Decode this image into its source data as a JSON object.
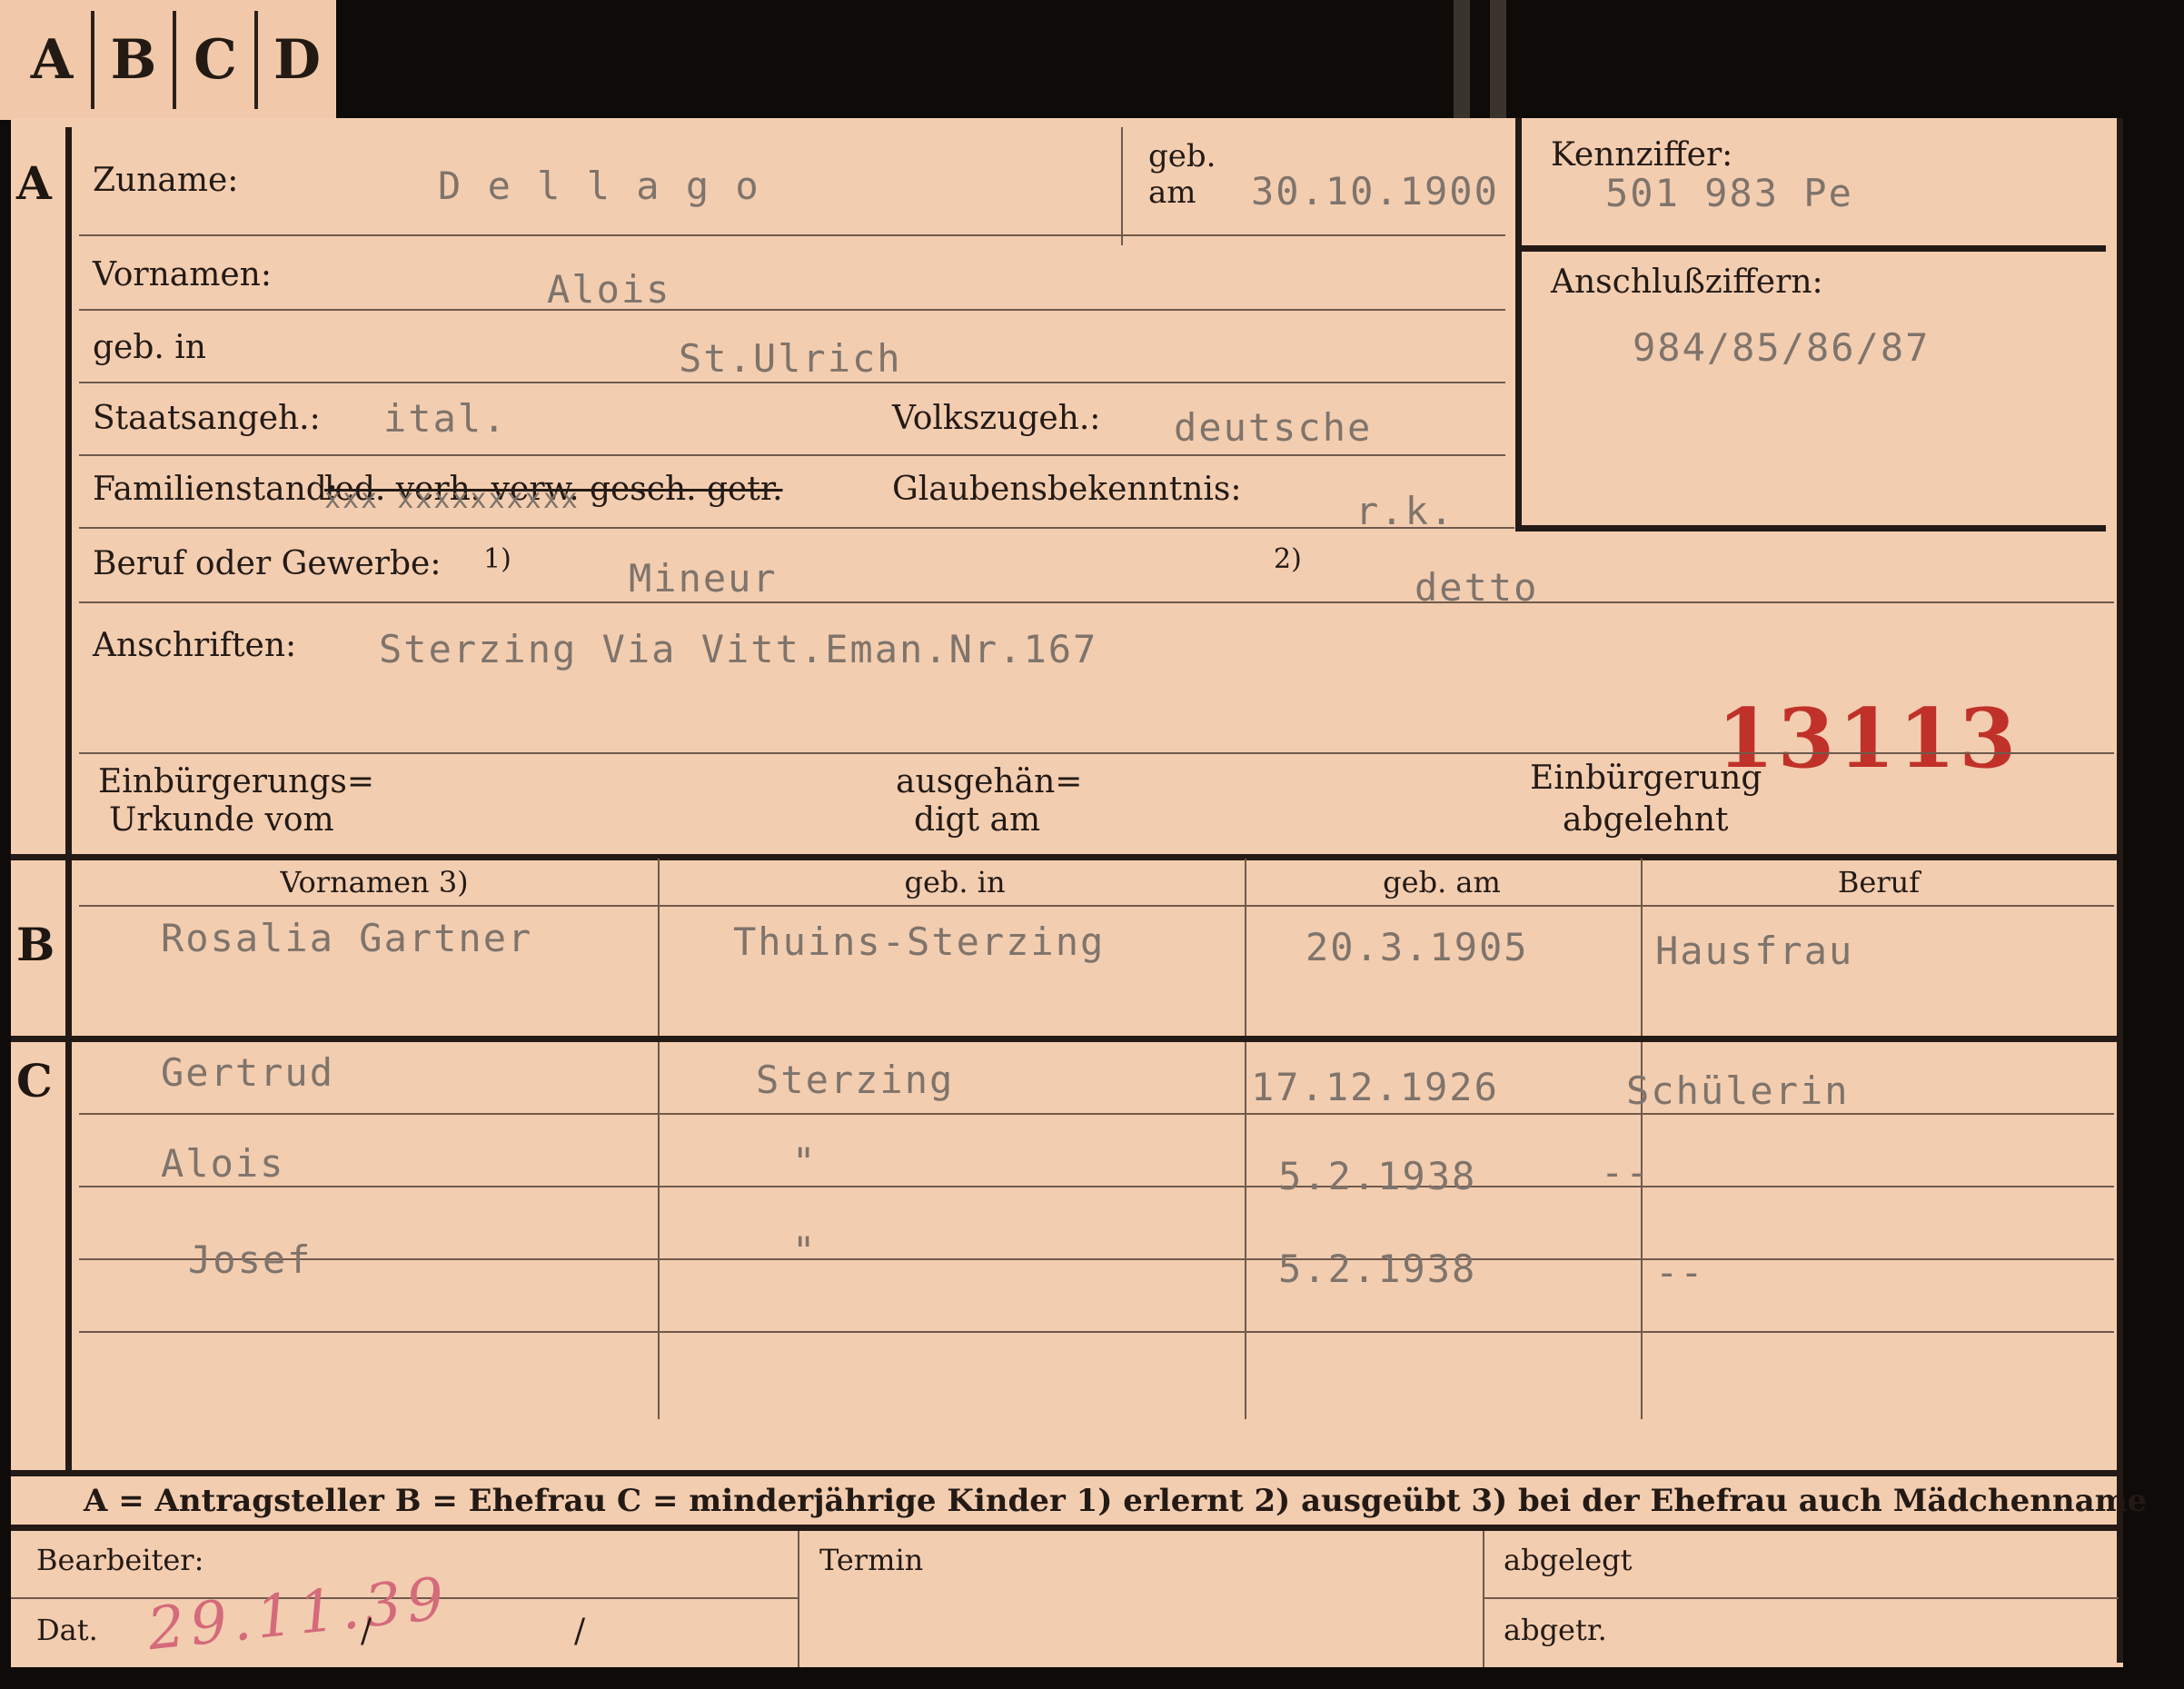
{
  "tabs": [
    "A",
    "B",
    "C",
    "D"
  ],
  "sections": {
    "a": "A",
    "b": "B",
    "c": "C"
  },
  "labels": {
    "zuname": "Zuname:",
    "geb_am_1": "geb.",
    "geb_am_2": "am",
    "kennziffer": "Kennziffer:",
    "vornamen": "Vornamen:",
    "anschlussziffern": "Anschlußziffern:",
    "geb_in": "geb. in",
    "staatsangeh": "Staatsangeh.:",
    "volkszugeh": "Volkszugeh.:",
    "familienstand": "Familienstand:",
    "familienstand_options": "led. verh. verw. gesch. getr.",
    "glaubensbekenntnis": "Glaubensbekenntnis:",
    "beruf": "Beruf oder Gewerbe:",
    "beruf_note1": "1)",
    "beruf_note2": "2)",
    "anschriften": "Anschriften:",
    "einbuergerungs_1": "Einbürgerungs=",
    "einbuergerungs_2": "Urkunde vom",
    "ausgehaen_1": "ausgehän=",
    "ausgehaen_2": "digt am",
    "einbuergerung_1": "Einbürgerung",
    "einbuergerung_2": "abgelehnt"
  },
  "values": {
    "zuname": "D e l l a g o",
    "geb_am": "30.10.1900",
    "kennziffer": "501 983  Pe",
    "vornamen": "Alois",
    "anschlussziffern": "984/85/86/87",
    "geb_in": "St.Ulrich",
    "staatsangeh": "ital.",
    "volkszugeh": "deutsche",
    "familienstand_marks": "xxx         xxxxxxxxxx",
    "glaubensbekenntnis": "r.k.",
    "beruf1": "Mineur",
    "beruf2": "detto",
    "anschriften": "Sterzing Via Vitt.Eman.Nr.167",
    "stamp_number": "13113"
  },
  "section_b": {
    "headers": [
      "Vornamen 3)",
      "geb. in",
      "geb. am",
      "Beruf"
    ],
    "row": [
      "Rosalia Gartner",
      "Thuins-Sterzing",
      "20.3.1905",
      "Hausfrau"
    ]
  },
  "section_c": {
    "rows": [
      [
        "Gertrud",
        "Sterzing",
        "17.12.1926",
        "Schülerin"
      ],
      [
        "Alois",
        "\"",
        "5.2.1938",
        "--"
      ],
      [
        "Josef",
        "\"",
        "5.2.1938",
        "--"
      ]
    ]
  },
  "legend": {
    "text": "A = Antragsteller   B = Ehefrau   C = minderjährige Kinder   1) erlernt   2) ausgeübt   3) bei der Ehefrau auch Mädchenname"
  },
  "footer": {
    "bearbeiter": "Bearbeiter:",
    "dat": "Dat.",
    "dat_handwritten": "29.11.39",
    "slash1": "/",
    "slash2": "/",
    "termin": "Termin",
    "abgelegt": "abgelegt",
    "abgetr": "abgetr."
  },
  "colors": {
    "card": "#f3cdb0",
    "ink": "#231a15",
    "typewriter": "#7f746b",
    "stamp": "#c0312a",
    "pencil": "#d46a7a"
  }
}
